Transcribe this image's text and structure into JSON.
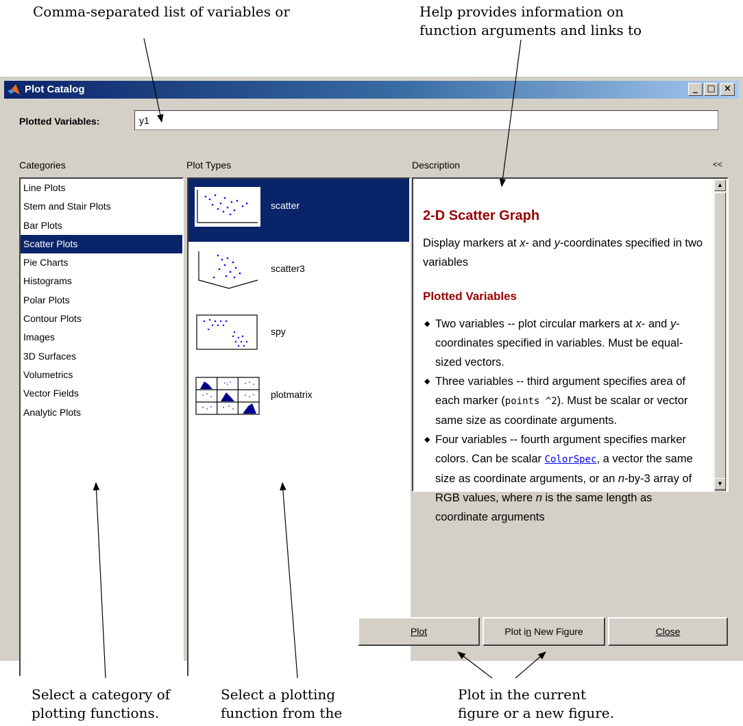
{
  "callouts": {
    "top_left": "Comma-separated list of variables or",
    "top_right_line1": "Help provides information on",
    "top_right_line2": "function arguments and links to",
    "bottom_categories_line1": "Select a category of",
    "bottom_categories_line2": "plotting functions.",
    "bottom_function_line1": "Select a plotting",
    "bottom_function_line2": "function from the",
    "bottom_plot_line1": "Plot in the current",
    "bottom_plot_line2": "figure or a new figure."
  },
  "window": {
    "title": "Plot Catalog",
    "title_icon": "matlab-logo-icon",
    "controls": [
      "minimize-icon",
      "maximize-icon",
      "close-icon"
    ]
  },
  "plotted_variables": {
    "label": "Plotted Variables:",
    "value": "y1"
  },
  "labels": {
    "categories": "Categories",
    "plot_types": "Plot Types",
    "description": "Description",
    "collapse": "<<"
  },
  "categories": {
    "items": [
      "Line Plots",
      "Stem and Stair Plots",
      "Bar Plots",
      "Scatter Plots",
      "Pie Charts",
      "Histograms",
      "Polar Plots",
      "Contour Plots",
      "Images",
      "3D Surfaces",
      "Volumetrics",
      "Vector Fields",
      "Analytic Plots"
    ],
    "selected": "Scatter Plots"
  },
  "plot_types": {
    "items": [
      "scatter",
      "scatter3",
      "spy",
      "plotmatrix"
    ],
    "selected": "scatter"
  },
  "description": {
    "heading": "2-D Scatter Graph",
    "intro_pre": "Display markers at ",
    "intro_x": "x",
    "intro_mid": "- and ",
    "intro_y": "y",
    "intro_post": "-coordinates specified in two variables",
    "subheading": "Plotted Variables",
    "b1_pre": "Two variables -- plot circular markers at ",
    "b1_x": "x",
    "b1_mid": "- and ",
    "b1_y": "y",
    "b1_post": "-coordinates specified in variables. Must be equal-sized vectors.",
    "b2_pre": "Three variables -- third argument specifies area of each marker (",
    "b2_code": "points ^2",
    "b2_post": "). Must be scalar or vector same size as coordinate arguments.",
    "b3_pre": "Four variables -- fourth argument specifies marker colors. Can be scalar ",
    "b3_link": "ColorSpec",
    "b3_mid": ", a vector the same size as coordinate arguments, or an ",
    "b3_n1": "n",
    "b3_mid2": "-by-3 array of RGB values, where ",
    "b3_n2": "n",
    "b3_post": " is the same length as coordinate arguments"
  },
  "buttons": {
    "plot": "Plot",
    "plot_new_pre": "Plot i",
    "plot_new_u": "n",
    "plot_new_post": " New Figure",
    "close": "Close"
  },
  "colors": {
    "selection": "#0a246a",
    "heading_red": "#990000",
    "dialog_gray": "#d4d0c8",
    "plot_marker_blue": "#0000ff"
  }
}
